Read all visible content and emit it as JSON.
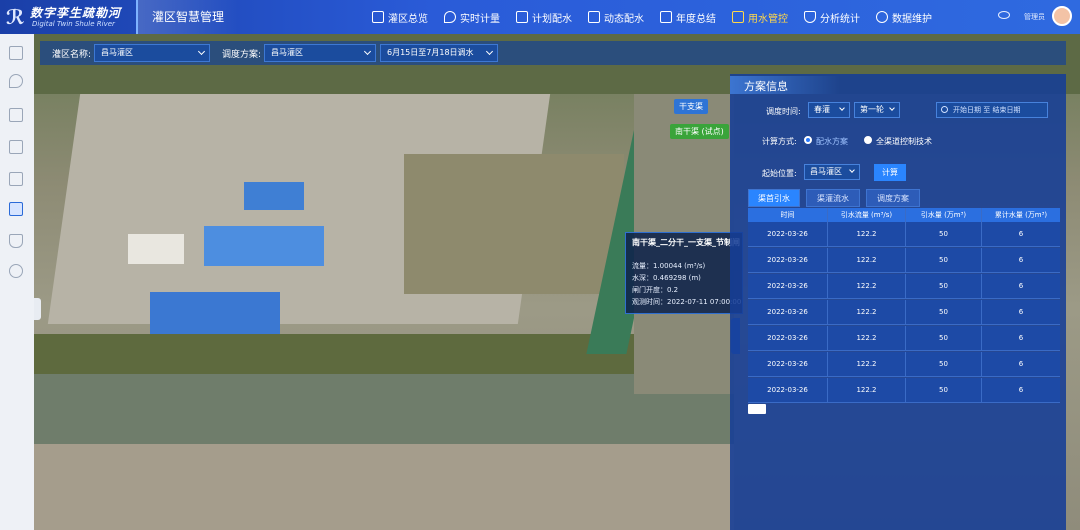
{
  "header": {
    "logo_cn": "数字孪生疏勒河",
    "logo_en": "Digital Twin Shule River",
    "system_title": "灌区智慧管理",
    "nav": [
      {
        "label": "灌区总览",
        "icon": "grid-icon"
      },
      {
        "label": "实时计量",
        "icon": "drop-icon"
      },
      {
        "label": "计划配水",
        "icon": "calendar-icon"
      },
      {
        "label": "动态配水",
        "icon": "doc-icon"
      },
      {
        "label": "年度总结",
        "icon": "report-icon"
      },
      {
        "label": "用水管控",
        "icon": "hand-water-icon",
        "active": true
      },
      {
        "label": "分析统计",
        "icon": "shield-icon"
      },
      {
        "label": "数据维护",
        "icon": "gear-icon"
      }
    ],
    "user_name": "管理员",
    "active_color": "#ffd84a"
  },
  "filter": {
    "district_label": "灌区名称:",
    "district_value": "昌马灌区",
    "plan_label": "调度方案:",
    "plan_value": "昌马灌区",
    "period_value": "6月15日至7月18日调水"
  },
  "map": {
    "tag_ganzhi": "干支渠",
    "tag_nanganqu": "南干渠 (试点)",
    "popup": {
      "title": "南干渠_二分干_一支渠_节制闸",
      "flow": "流量：1.00044 (m³/s)",
      "depth": "水深：0.469298 (m)",
      "gate": "闸门开度：0.2",
      "time": "观测时间：2022-07-11 07:00:00"
    }
  },
  "panel": {
    "title": "方案信息",
    "schedule_label": "调度时间:",
    "season": "春灌",
    "round": "第一轮",
    "start_placeholder": "开始日期",
    "to": "至",
    "end_placeholder": "结束日期",
    "method_label": "计算方式:",
    "method_opt1": "配水方案",
    "method_opt2": "全渠道控制技术",
    "start_pos_label": "起始位置:",
    "start_pos_value": "昌马灌区",
    "calc_button": "计算",
    "tabs": [
      "渠首引水",
      "渠灌流水",
      "调度方案"
    ],
    "table": {
      "headers": [
        "时间",
        "引水流量 (m³/s)",
        "引水量 (万m³)",
        "累计水量 (万m³)"
      ],
      "rows": [
        [
          "2022-03-26",
          "122.2",
          "50",
          "6"
        ],
        [
          "2022-03-26",
          "122.2",
          "50",
          "6"
        ],
        [
          "2022-03-26",
          "122.2",
          "50",
          "6"
        ],
        [
          "2022-03-26",
          "122.2",
          "50",
          "6"
        ],
        [
          "2022-03-26",
          "122.2",
          "50",
          "6"
        ],
        [
          "2022-03-26",
          "122.2",
          "50",
          "6"
        ],
        [
          "2022-03-26",
          "122.2",
          "50",
          "6"
        ]
      ]
    }
  }
}
